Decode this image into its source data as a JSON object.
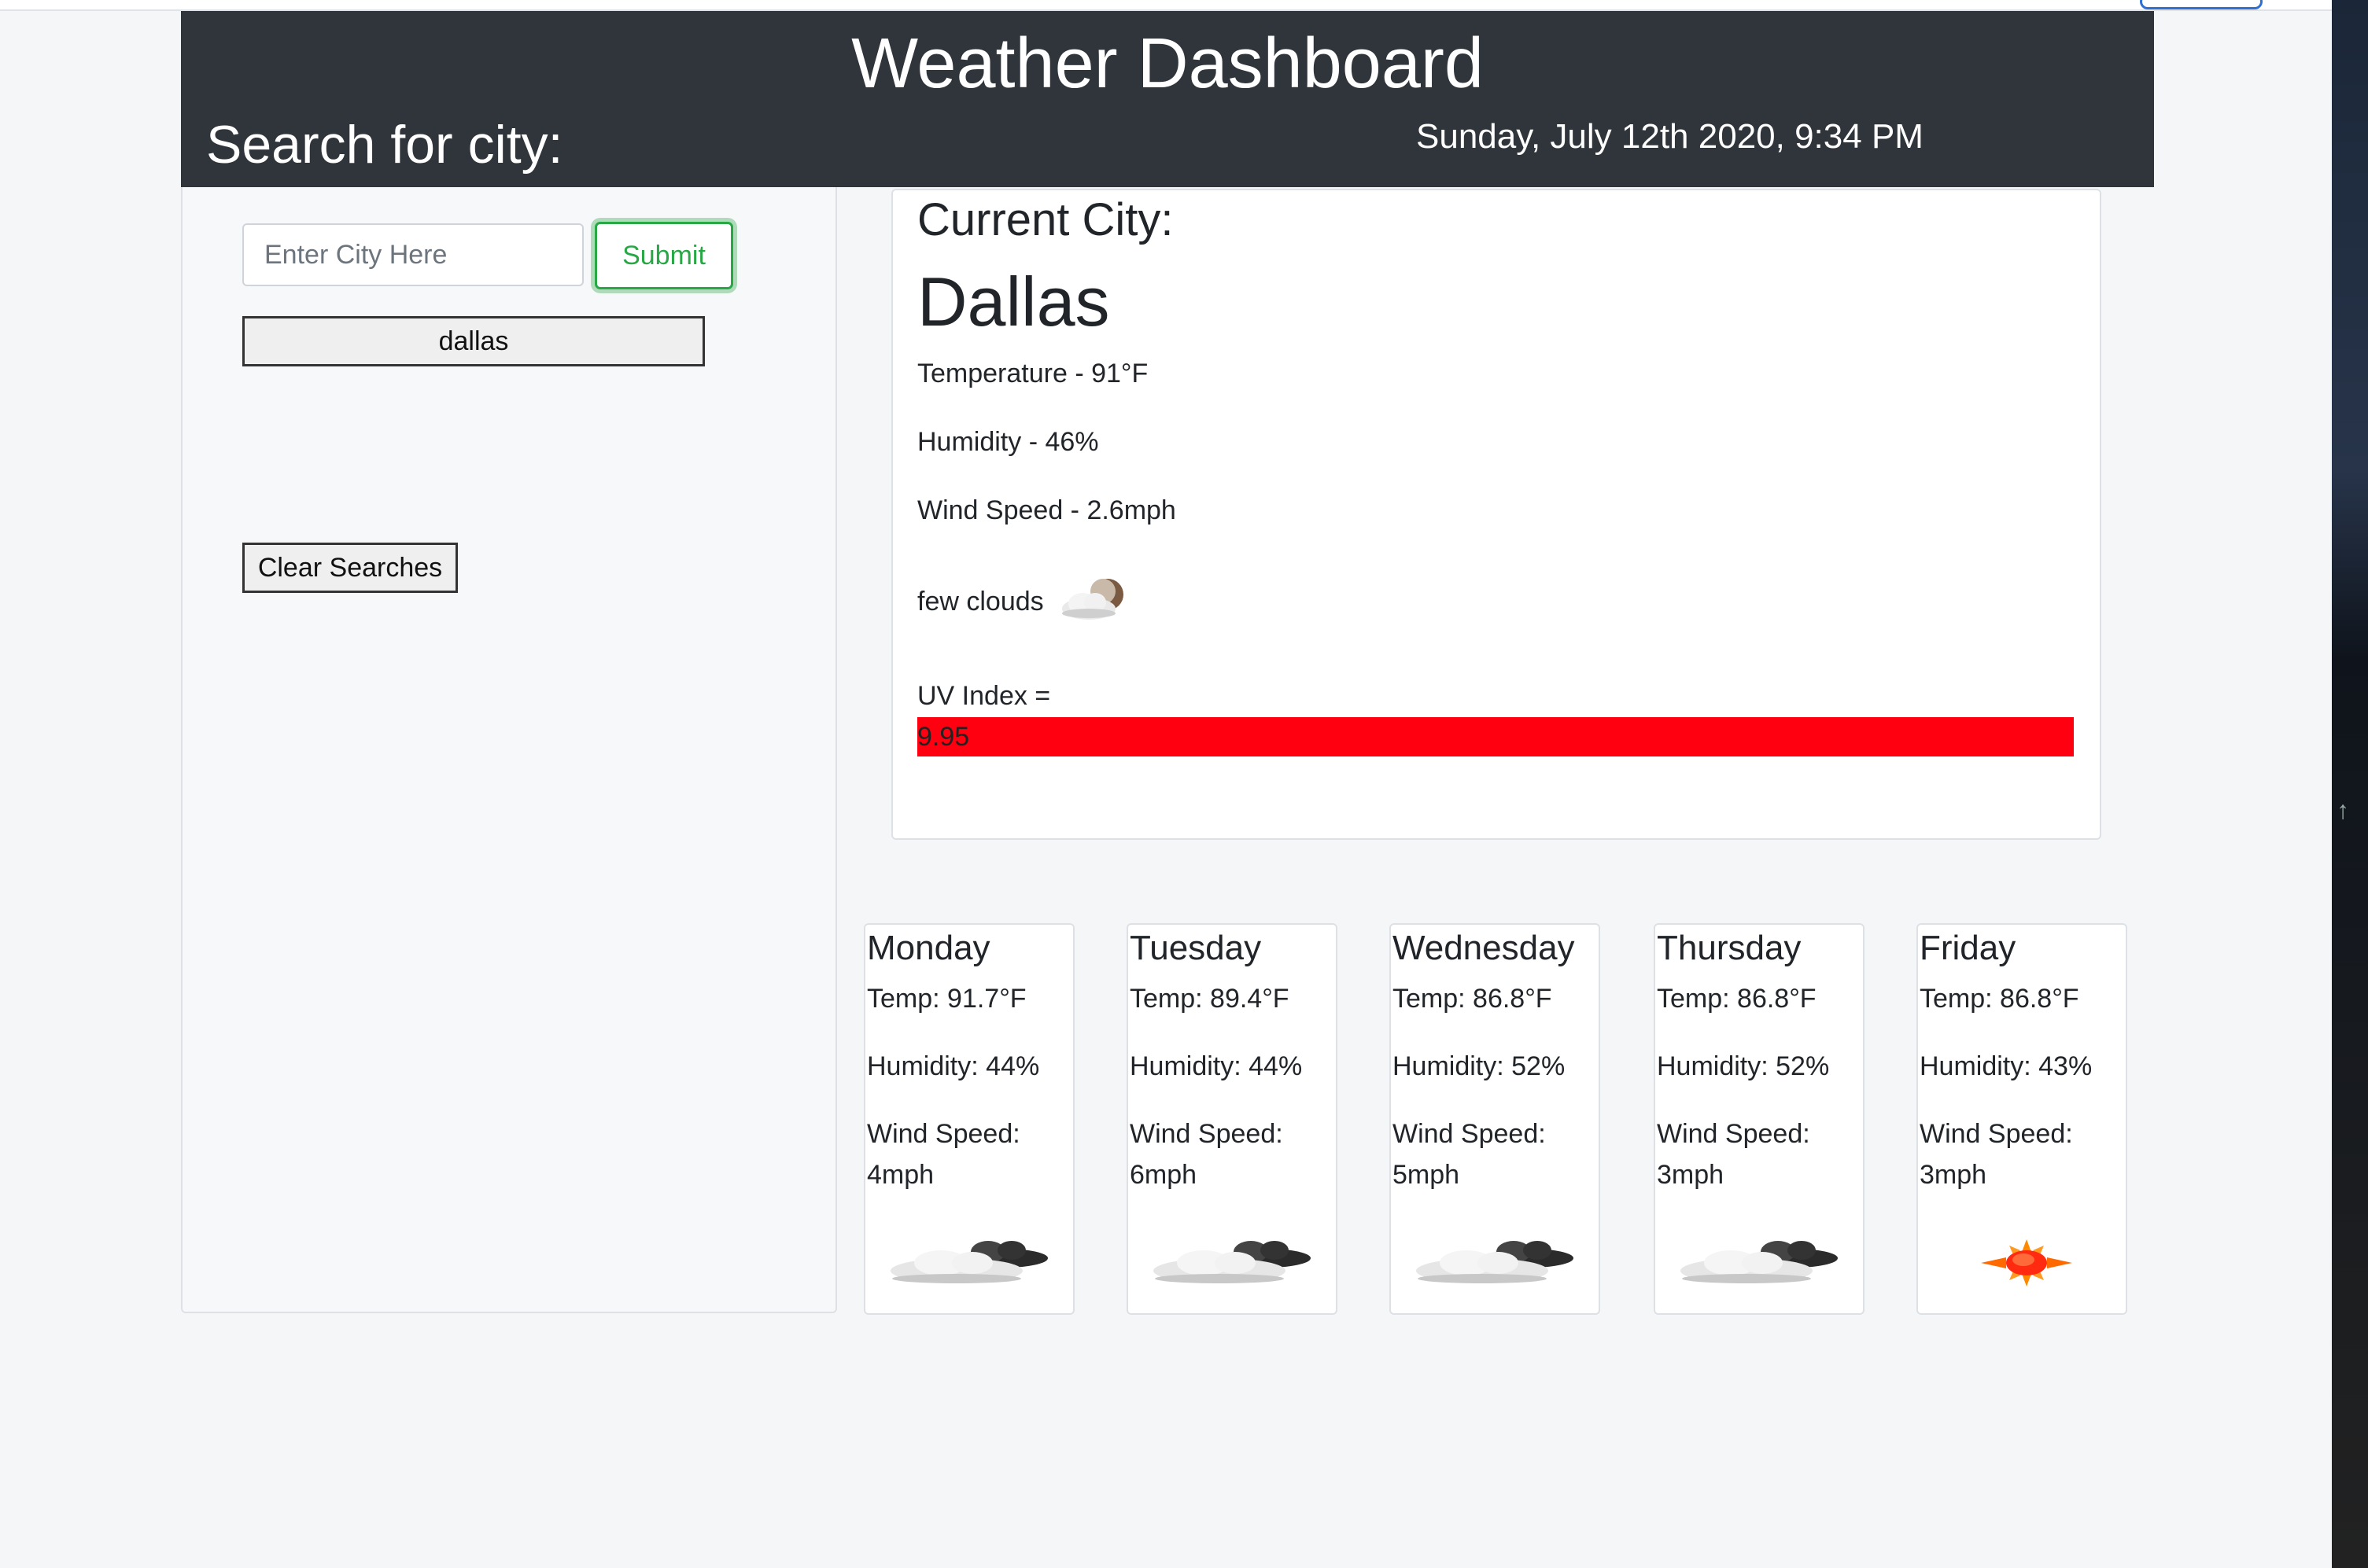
{
  "header": {
    "title": "Weather Dashboard",
    "search_title": "Search for city:",
    "datetime": "Sunday, July 12th 2020, 9:34 PM"
  },
  "search": {
    "placeholder": "Enter City Here",
    "submit_label": "Submit",
    "history": [
      "dallas"
    ],
    "clear_label": "Clear Searches"
  },
  "current": {
    "label": "Current City:",
    "city": "Dallas",
    "temperature": "Temperature - 91°F",
    "humidity": "Humidity - 46%",
    "wind": "Wind Speed - 2.6mph",
    "description": "few clouds",
    "icon": "few-clouds-night-icon",
    "uv_label": "UV Index =",
    "uv_value": "9.95",
    "uv_color": "#ff0011"
  },
  "forecast": [
    {
      "day": "Monday",
      "temp": "Temp: 91.7°F",
      "humidity": "Humidity: 44%",
      "wind": "Wind Speed: 4mph",
      "icon": "broken-clouds-icon"
    },
    {
      "day": "Tuesday",
      "temp": "Temp: 89.4°F",
      "humidity": "Humidity: 44%",
      "wind": "Wind Speed: 6mph",
      "icon": "broken-clouds-icon"
    },
    {
      "day": "Wednesday",
      "temp": "Temp: 86.8°F",
      "humidity": "Humidity: 52%",
      "wind": "Wind Speed: 5mph",
      "icon": "broken-clouds-icon"
    },
    {
      "day": "Thursday",
      "temp": "Temp: 86.8°F",
      "humidity": "Humidity: 52%",
      "wind": "Wind Speed: 3mph",
      "icon": "broken-clouds-icon"
    },
    {
      "day": "Friday",
      "temp": "Temp: 86.8°F",
      "humidity": "Humidity: 43%",
      "wind": "Wind Speed: 3mph",
      "icon": "clear-sky-sun-icon"
    }
  ],
  "colors": {
    "header_bg": "#2f353b",
    "accent_green": "#28a745",
    "page_bg": "#f5f6f8"
  }
}
